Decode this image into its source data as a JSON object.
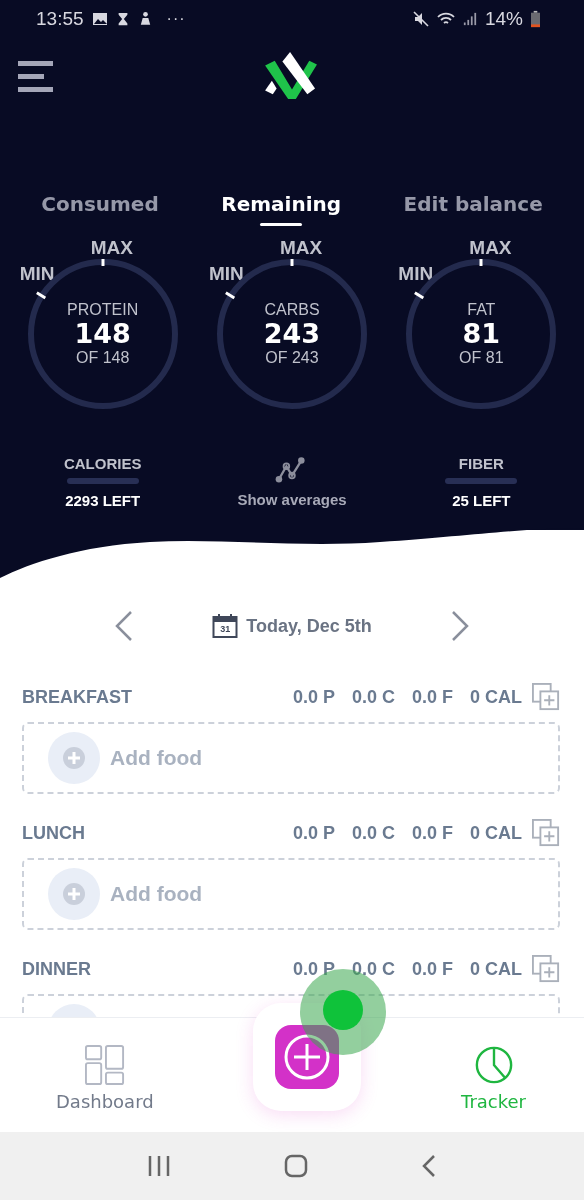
{
  "status_bar": {
    "time": "13:55",
    "more": "···",
    "battery": "14%"
  },
  "tabs": [
    {
      "label": "Consumed",
      "selected": false
    },
    {
      "label": "Remaining",
      "selected": true
    },
    {
      "label": "Edit balance",
      "selected": false
    }
  ],
  "gauges": [
    {
      "min_label": "MIN",
      "max_label": "MAX",
      "name": "PROTEIN",
      "value": "148",
      "of": "OF 148"
    },
    {
      "min_label": "MIN",
      "max_label": "MAX",
      "name": "CARBS",
      "value": "243",
      "of": "OF 243"
    },
    {
      "min_label": "MIN",
      "max_label": "MAX",
      "name": "FAT",
      "value": "81",
      "of": "OF 81"
    }
  ],
  "calories": {
    "label": "CALORIES",
    "reading": "2293 LEFT"
  },
  "averages": {
    "label": "Show averages"
  },
  "fiber": {
    "label": "FIBER",
    "reading": "25 LEFT"
  },
  "date": {
    "label": "Today, Dec 5th",
    "calendar_day": "31"
  },
  "meals": [
    {
      "name": "BREAKFAST",
      "protein": "0.0 P",
      "carbs": "0.0 C",
      "fat": "0.0 F",
      "calories": "0 CAL",
      "add_label": "Add food"
    },
    {
      "name": "LUNCH",
      "protein": "0.0 P",
      "carbs": "0.0 C",
      "fat": "0.0 F",
      "calories": "0 CAL",
      "add_label": "Add food"
    },
    {
      "name": "DINNER",
      "protein": "0.0 P",
      "carbs": "0.0 C",
      "fat": "0.0 F",
      "calories": "0 CAL"
    }
  ],
  "bottom_nav": [
    {
      "kind": "dashboard",
      "label": "Dashboard",
      "selected": false
    },
    {
      "kind": "add"
    },
    {
      "kind": "tracker",
      "label": "Tracker",
      "selected": true
    }
  ]
}
